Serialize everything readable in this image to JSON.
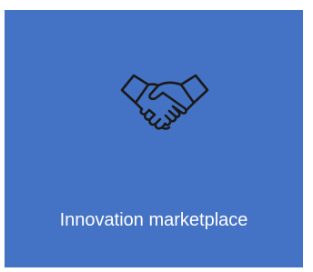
{
  "tile": {
    "label": "Innovation marketplace",
    "icon": "handshake-icon",
    "background_color": "#4472c4",
    "text_color": "#ffffff"
  }
}
